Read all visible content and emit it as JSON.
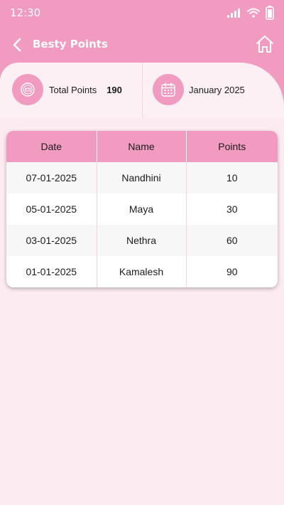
{
  "status_bar": {
    "time": "12:30"
  },
  "nav": {
    "title": "Besty Points",
    "back_icon": "chevron-left-icon",
    "home_icon": "home-icon"
  },
  "summary": {
    "total_label": "Total Points",
    "total_value": "190",
    "month": "January 2025"
  },
  "table": {
    "headers": [
      "Date",
      "Name",
      "Points"
    ],
    "rows": [
      {
        "date": "07-01-2025",
        "name": "Nandhini",
        "points": "10"
      },
      {
        "date": "05-01-2025",
        "name": "Maya",
        "points": "30"
      },
      {
        "date": "03-01-2025",
        "name": "Nethra",
        "points": "60"
      },
      {
        "date": "01-01-2025",
        "name": "Kamalesh",
        "points": "90"
      }
    ]
  },
  "colors": {
    "brand_pink": "#f19bc1",
    "background": "#fdebf2",
    "card": "#fdf0f5"
  }
}
